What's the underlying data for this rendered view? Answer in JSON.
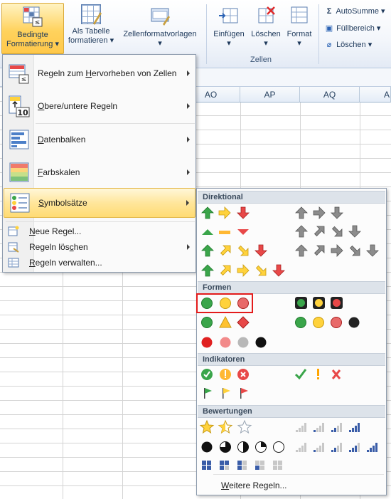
{
  "ribbon": {
    "bedingte_line1": "Bedingte",
    "bedingte_line2": "Formatierung",
    "tabelle_line1": "Als Tabelle",
    "tabelle_line2": "formatieren",
    "zellen_vorlagen": "Zellenformatvorlagen",
    "einfuegen": "Einfügen",
    "loeschen": "Löschen",
    "format": "Format",
    "zellen_group": "Zellen",
    "autosumme": "AutoSumme",
    "fuellbereich": "Füllbereich",
    "loeschen_small": "Löschen",
    "sigma_glyph": "Σ"
  },
  "columns": [
    "AO",
    "AP",
    "AQ",
    "A"
  ],
  "menu": {
    "items": [
      {
        "label_pre": "Regeln zum ",
        "label_ul": "H",
        "label_post": "ervorheben von Zellen"
      },
      {
        "label_pre": "",
        "label_ul": "O",
        "label_post": "bere/untere Regeln"
      },
      {
        "label_pre": "",
        "label_ul": "D",
        "label_post": "atenbalken"
      },
      {
        "label_pre": "",
        "label_ul": "F",
        "label_post": "arbskalen"
      },
      {
        "label_pre": "",
        "label_ul": "S",
        "label_post": "ymbolsätze"
      }
    ],
    "small_items": [
      {
        "label_pre": "",
        "label_ul": "N",
        "label_post": "eue Regel..."
      },
      {
        "label_pre": "Regeln lös",
        "label_ul": "c",
        "label_post": "hen"
      },
      {
        "label_pre": "",
        "label_ul": "R",
        "label_post": "egeln verwalten..."
      }
    ],
    "topten_number": "10"
  },
  "submenu": {
    "sections": [
      "Direktional",
      "Formen",
      "Indikatoren",
      "Bewertungen"
    ],
    "more_pre": "",
    "more_ul": "W",
    "more_post": "eitere Regeln..."
  },
  "colors": {
    "green": "#3aa54a",
    "yellow": "#ffd23c",
    "red": "#e84848",
    "orange": "#f5a623",
    "gray": "#8c8c8c",
    "highlight": "#ffdb73",
    "selection_border": "#e31b1b"
  }
}
